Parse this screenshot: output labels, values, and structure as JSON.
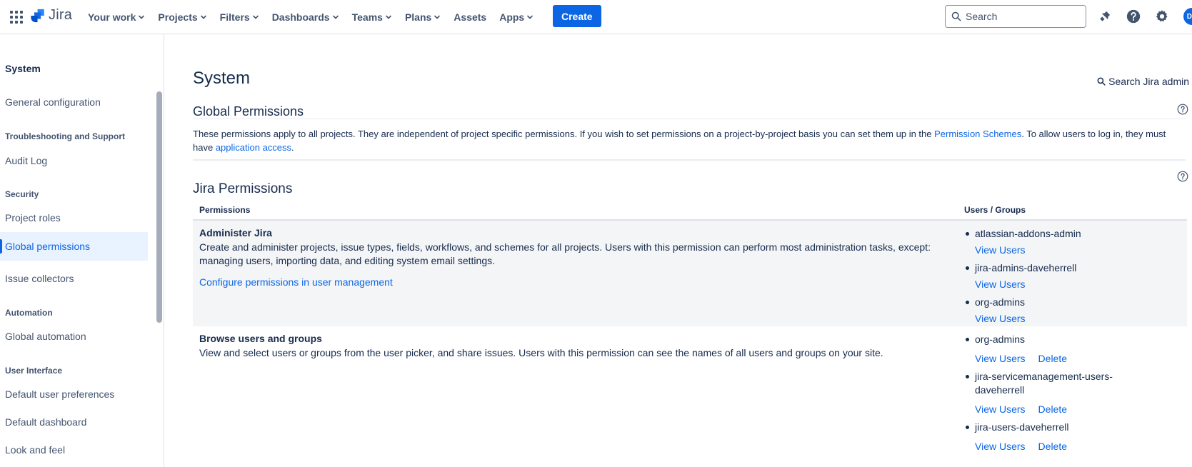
{
  "app": {
    "name": "Jira"
  },
  "nav": {
    "items": [
      {
        "label": "Your work",
        "dropdown": true
      },
      {
        "label": "Projects",
        "dropdown": true
      },
      {
        "label": "Filters",
        "dropdown": true
      },
      {
        "label": "Dashboards",
        "dropdown": true
      },
      {
        "label": "Teams",
        "dropdown": true
      },
      {
        "label": "Plans",
        "dropdown": true
      },
      {
        "label": "Assets",
        "dropdown": false
      },
      {
        "label": "Apps",
        "dropdown": true
      }
    ],
    "create_label": "Create",
    "search_placeholder": "Search",
    "avatar_initials": "DH",
    "accent": "#0c66e4"
  },
  "sidebar": {
    "title": "System",
    "general": "General configuration",
    "sections": {
      "troubleshooting": "Troubleshooting and Support",
      "security": "Security",
      "automation": "Automation",
      "user_interface": "User Interface"
    },
    "items": {
      "audit_log": "Audit Log",
      "project_roles": "Project roles",
      "global_permissions": "Global permissions",
      "issue_collectors": "Issue collectors",
      "global_automation": "Global automation",
      "default_user_prefs": "Default user preferences",
      "default_dashboard": "Default dashboard",
      "look_and_feel": "Look and feel"
    }
  },
  "main": {
    "title": "System",
    "search_admin": "Search Jira admin",
    "global_permissions": {
      "title": "Global Permissions",
      "desc_part1": "These permissions apply to all projects. They are independent of project specific permissions. If you wish to set permissions on a project-by-project basis you can set them up in the ",
      "permission_schemes_link": "Permission Schemes",
      "desc_part2": ". To allow users to log in, they must have ",
      "application_access_link": "application access",
      "desc_part3": "."
    },
    "jira_permissions": {
      "title": "Jira Permissions",
      "col_permissions": "Permissions",
      "col_users_groups": "Users / Groups",
      "rows": [
        {
          "name": "Administer Jira",
          "desc": "Create and administer projects, issue types, fields, workflows, and schemes for all projects. Users with this permission can perform most administration tasks, except: managing users, importing data, and editing system email settings.",
          "link": "Configure permissions in user management",
          "groups": [
            {
              "name": "atlassian-addons-admin",
              "view": "View Users"
            },
            {
              "name": "jira-admins-daveherrell",
              "view": "View Users"
            },
            {
              "name": "org-admins",
              "view": "View Users"
            }
          ]
        },
        {
          "name": "Browse users and groups",
          "desc": "View and select users or groups from the user picker, and share issues. Users with this permission can see the names of all users and groups on your site.",
          "groups": [
            {
              "name": "org-admins",
              "view": "View Users",
              "delete": "Delete"
            },
            {
              "name": "jira-servicemanagement-users-daveherrell",
              "view": "View Users",
              "delete": "Delete"
            },
            {
              "name": "jira-users-daveherrell",
              "view": "View Users",
              "delete": "Delete"
            }
          ]
        }
      ]
    }
  }
}
